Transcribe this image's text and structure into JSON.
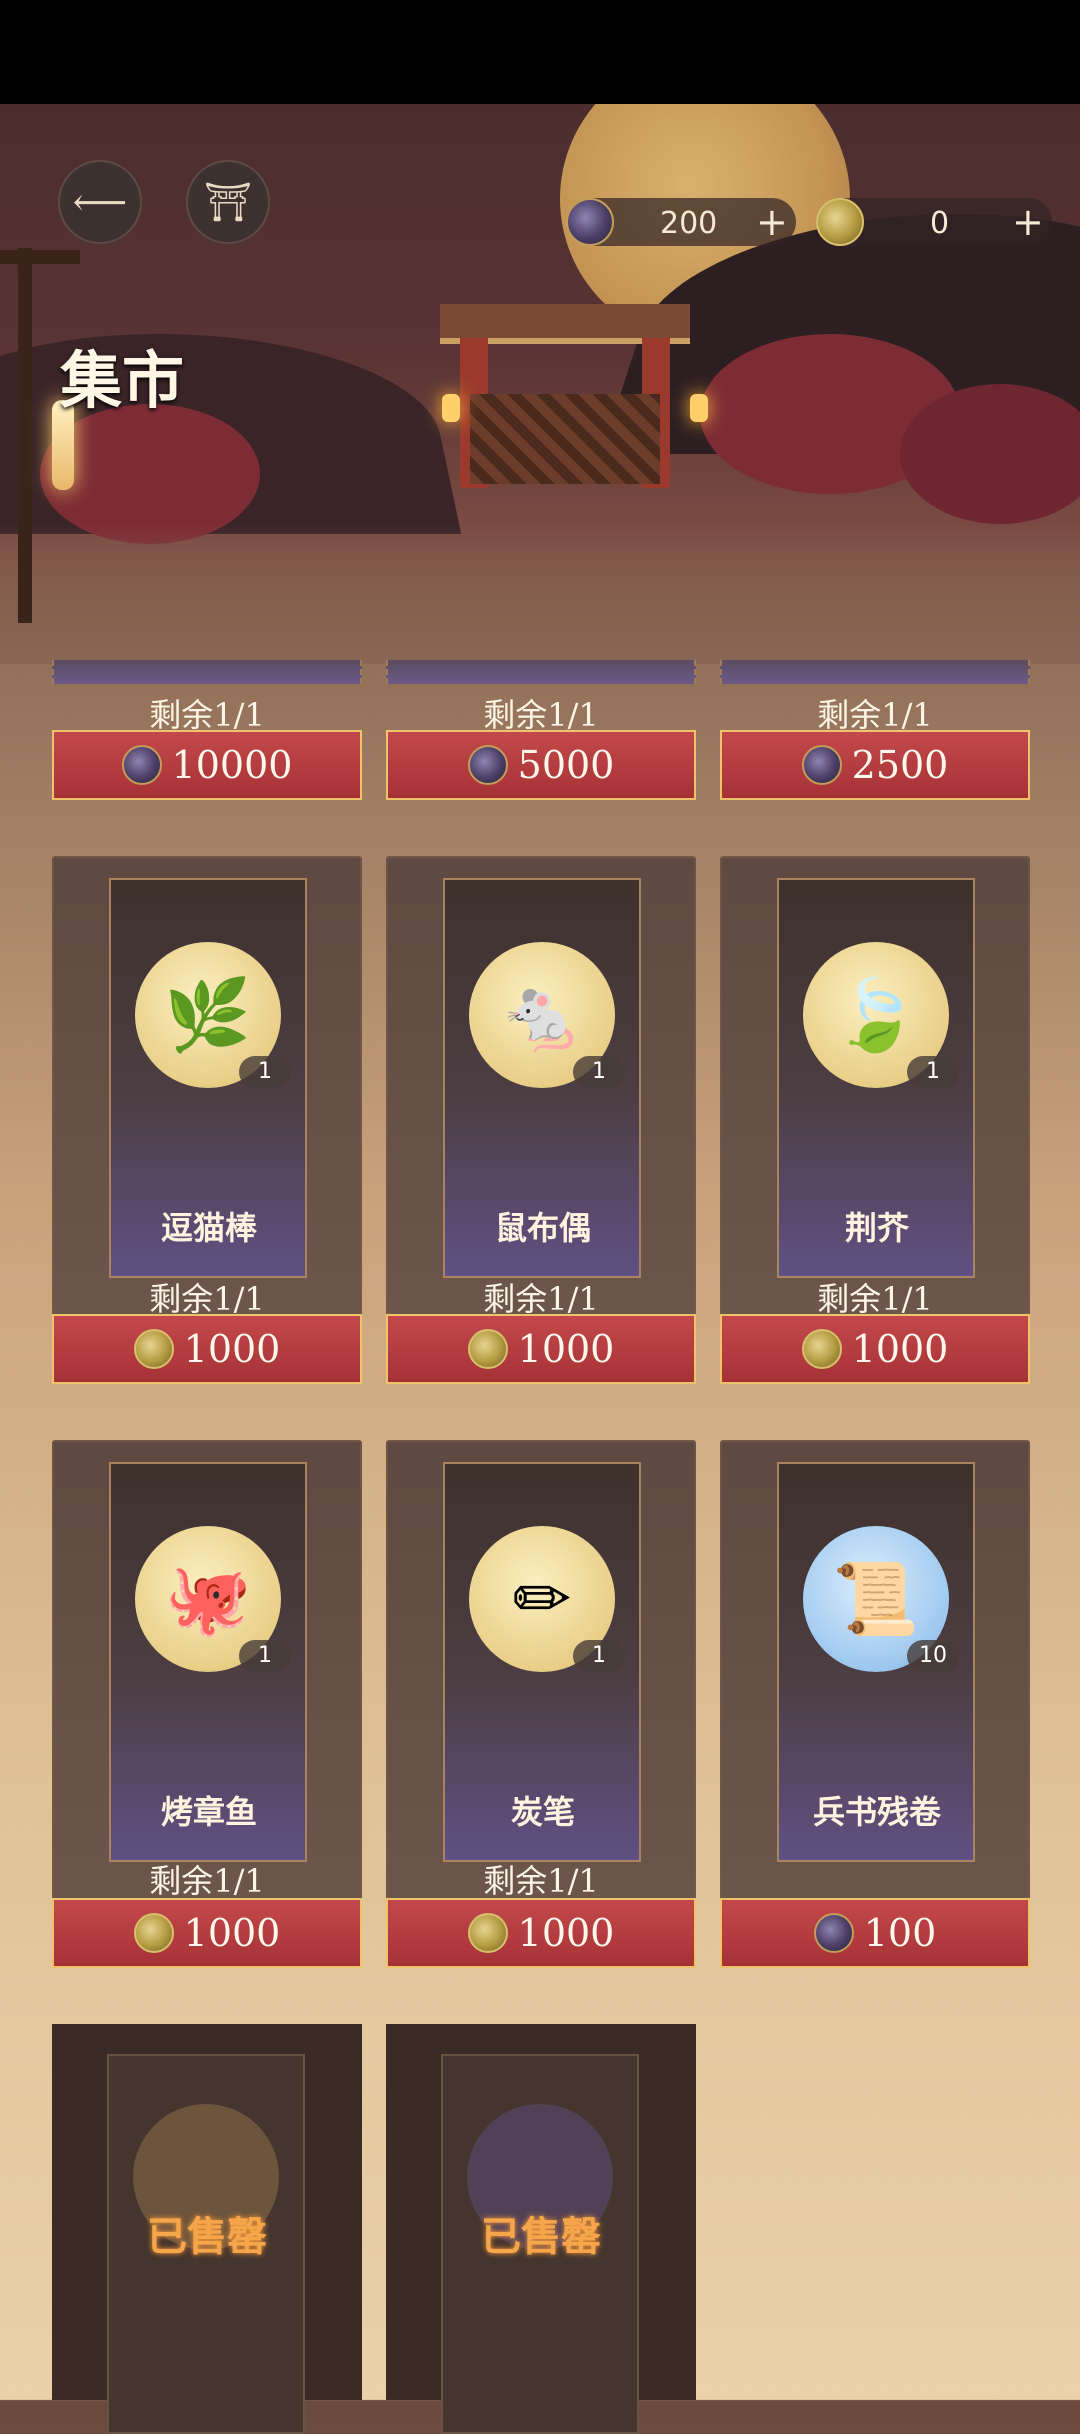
{
  "header": {
    "title": "集市",
    "back_icon": "back-arrow-icon",
    "home_icon": "pavilion-icon",
    "currencies": [
      {
        "icon": "gem-currency-icon",
        "value": "200",
        "plus": "+"
      },
      {
        "icon": "gold-coin-icon",
        "value": "0",
        "plus": "+"
      }
    ]
  },
  "top_row": [
    {
      "remain": "剩余1/1",
      "price": "10000",
      "currency": "gem"
    },
    {
      "remain": "剩余1/1",
      "price": "5000",
      "currency": "gem"
    },
    {
      "remain": "剩余1/1",
      "price": "2500",
      "currency": "gem"
    }
  ],
  "items": [
    {
      "name": "逗猫棒",
      "qty": "1",
      "remain": "剩余1/1",
      "price": "1000",
      "currency": "gold",
      "icon": "cat-teaser-icon"
    },
    {
      "name": "鼠布偶",
      "qty": "1",
      "remain": "剩余1/1",
      "price": "1000",
      "currency": "gold",
      "icon": "mouse-doll-icon"
    },
    {
      "name": "荆芥",
      "qty": "1",
      "remain": "剩余1/1",
      "price": "1000",
      "currency": "gold",
      "icon": "catnip-icon"
    },
    {
      "name": "烤章鱼",
      "qty": "1",
      "remain": "剩余1/1",
      "price": "1000",
      "currency": "gold",
      "icon": "grilled-octopus-icon"
    },
    {
      "name": "炭笔",
      "qty": "1",
      "remain": "剩余1/1",
      "price": "1000",
      "currency": "gold",
      "icon": "charcoal-icon"
    },
    {
      "name": "兵书残卷",
      "qty": "10",
      "remain": "",
      "price": "100",
      "currency": "gem",
      "icon": "scroll-icon"
    }
  ],
  "sold_out": [
    {
      "label": "已售罄"
    },
    {
      "label": "已售罄"
    }
  ],
  "colors": {
    "price_bg": "#b03a3e",
    "price_border": "#f0c36a",
    "sold_text": "#f6a64a"
  }
}
